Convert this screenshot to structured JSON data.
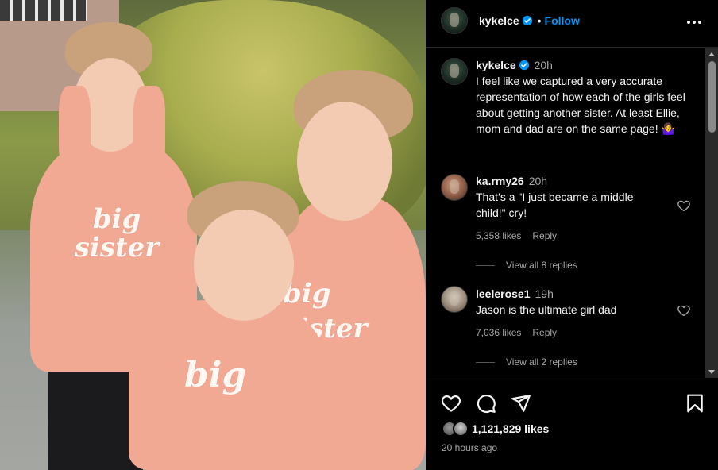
{
  "post": {
    "username": "kykelce",
    "follow_label": "Follow",
    "separator": "•",
    "caption_time": "20h",
    "caption": "I feel like we captured a very accurate representation of how each of the girls feel about getting another sister. At least Ellie, mom and dad are on the same page! 🤷‍♀️",
    "photo_text": {
      "left": "big sister",
      "middle": "big",
      "right": "big sister"
    }
  },
  "comments": [
    {
      "username": "ka.rmy26",
      "time": "20h",
      "text": "That’s a \"I just became a middle child!\" cry!",
      "likes": "5,358 likes",
      "reply_label": "Reply",
      "view_replies": "View all 8 replies"
    },
    {
      "username": "leelerose1",
      "time": "19h",
      "text": "Jason is the ultimate girl dad",
      "likes": "7,036 likes",
      "reply_label": "Reply",
      "view_replies": "View all 2 replies"
    }
  ],
  "footer": {
    "likes_count": "1,121,829 likes",
    "time_ago": "20 hours ago"
  },
  "icons": {
    "more": "more-horizontal-icon",
    "verified": "verified-badge-icon",
    "like": "heart-icon",
    "comment": "comment-icon",
    "share": "share-icon",
    "save": "bookmark-icon"
  },
  "colors": {
    "accent": "#0095f6",
    "verified": "#0095f6",
    "background": "#000000",
    "muted_text": "#a8a8a8"
  }
}
